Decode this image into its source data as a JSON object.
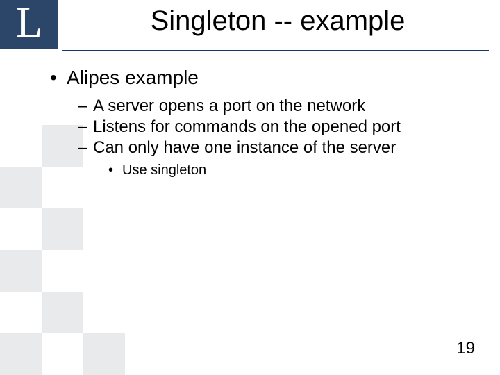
{
  "slide": {
    "logoLetter": "L",
    "title": "Singleton -- example",
    "bullet1": "Alipes example",
    "sub1": "A server opens a port on the network",
    "sub2": "Listens for commands on the opened port",
    "sub3": "Can only have one instance of the server",
    "subsub1": "Use singleton",
    "pageNumber": "19"
  }
}
